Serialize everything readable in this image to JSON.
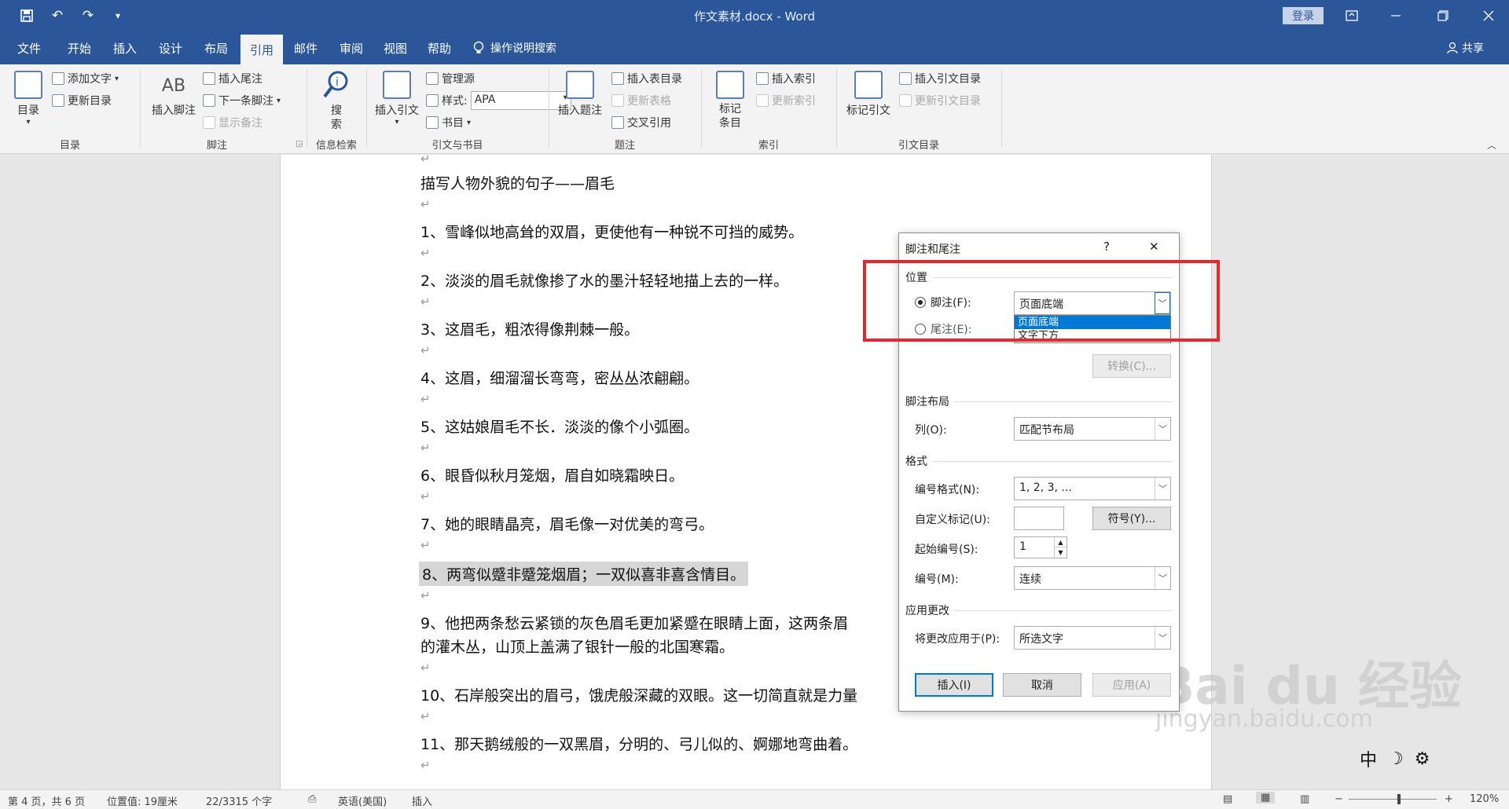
{
  "title_bar": {
    "doc_title": "作文素材.docx - Word",
    "login": "登录",
    "qa_undo": "↶",
    "qa_redo": "↷"
  },
  "tabs": [
    "文件",
    "开始",
    "插入",
    "设计",
    "布局",
    "引用",
    "邮件",
    "审阅",
    "视图",
    "帮助"
  ],
  "active_tab": "引用",
  "tellme": "操作说明搜索",
  "share": "共享",
  "ribbon": {
    "toc": {
      "big": "目录",
      "add_text": "添加文字",
      "update": "更新目录",
      "label": "目录"
    },
    "footnote": {
      "insert_footnote": "插入脚注",
      "insert_endnote": "插入尾注",
      "next_footnote": "下一条脚注",
      "show_notes": "显示备注",
      "label": "脚注",
      "ab_icon": "AB"
    },
    "research": {
      "search": "搜索",
      "label": "信息检索"
    },
    "citations": {
      "insert_citation": "插入引文",
      "manage": "管理源",
      "style_label": "样式:",
      "style_value": "APA",
      "bibliography": "书目",
      "label": "引文与书目"
    },
    "captions": {
      "insert_caption": "插入题注",
      "insert_table_fig": "插入表目录",
      "update_table": "更新表格",
      "cross_ref": "交叉引用",
      "label": "题注"
    },
    "index": {
      "mark_entry": "标记条目",
      "insert_index": "插入索引",
      "update_index": "更新索引",
      "label": "索引"
    },
    "toa": {
      "mark_citation": "标记引文",
      "insert_toa": "插入引文目录",
      "update_toa": "更新引文目录",
      "label": "引文目录"
    }
  },
  "document": {
    "heading": "描写人物外貌的句子——眉毛",
    "paragraphs": [
      "1、雪峰似地高耸的双眉，更使他有一种锐不可挡的威势。",
      "2、淡淡的眉毛就像掺了水的墨汁轻轻地描上去的一样。",
      "3、这眉毛，粗浓得像荆棘一般。",
      "4、这眉，细溜溜长弯弯，密丛丛浓翩翩。",
      "5、这姑娘眉毛不长．淡淡的像个小弧圈。",
      "6、眼昏似秋月笼烟，眉自如晓霜映日。",
      "7、她的眼睛晶亮，眉毛像一对优美的弯弓。",
      "8、两弯似蹙非蹙笼烟眉；一双似喜非喜含情目。",
      "9、他把两条愁云紧锁的灰色眉毛更加紧蹙在眼睛上面，这两条眉",
      "的灌木丛，山顶上盖满了银针一般的北国寒霜。",
      "10、石岸般突出的眉弓，饿虎般深藏的双眼。这一切简直就是力量",
      "11、那天鹅绒般的一双黑眉，分明的、弓儿似的、婀娜地弯曲着。"
    ],
    "para_mark": "↵"
  },
  "dialog": {
    "title": "脚注和尾注",
    "help": "?",
    "close": "✕",
    "position_section": "位置",
    "footnote_label": "脚注(F):",
    "footnote_value": "页面底端",
    "endnote_label": "尾注(E):",
    "dropdown_options": [
      "页面底端",
      "文字下方"
    ],
    "convert_button": "转换(C)...",
    "layout_section": "脚注布局",
    "columns_label": "列(O):",
    "columns_value": "匹配节布局",
    "format_section": "格式",
    "number_format_label": "编号格式(N):",
    "number_format_value": "1, 2, 3, ...",
    "custom_mark_label": "自定义标记(U):",
    "custom_mark_value": "",
    "symbol_button": "符号(Y)...",
    "start_at_label": "起始编号(S):",
    "start_at_value": "1",
    "numbering_label": "编号(M):",
    "numbering_value": "连续",
    "apply_section": "应用更改",
    "apply_to_label": "将更改应用于(P):",
    "apply_to_value": "所选文字",
    "insert_button": "插入(I)",
    "cancel_button": "取消",
    "apply_button": "应用(A)"
  },
  "status_bar": {
    "page": "第 4 页，共 6 页",
    "position": "位置值: 19厘米",
    "words": "22/3315 个字",
    "language": "英语(美国)",
    "mode": "插入",
    "zoom": "120%",
    "zoom_minus": "−",
    "zoom_plus": "+"
  },
  "watermark": {
    "logo": "Bai du 经验",
    "url": "jingyan.baidu.com"
  },
  "ime": {
    "lang": "中",
    "moon": "☽",
    "gear": "⚙"
  },
  "colors": {
    "brand": "#2b579a",
    "highlight": "#e8262b",
    "selected": "#0078d7"
  }
}
